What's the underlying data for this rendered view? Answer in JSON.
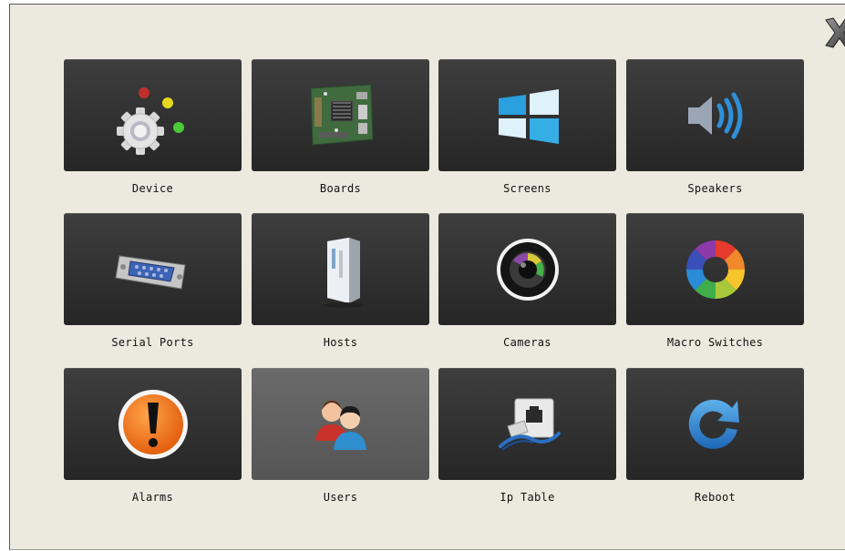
{
  "window": {
    "close_icon": "close-x-icon"
  },
  "tiles": [
    {
      "label": "Device",
      "icon": "gear-leds-icon",
      "selected": false
    },
    {
      "label": "Boards",
      "icon": "circuit-board-icon",
      "selected": false
    },
    {
      "label": "Screens",
      "icon": "screens-windows-icon",
      "selected": false
    },
    {
      "label": "Speakers",
      "icon": "speaker-icon",
      "selected": false
    },
    {
      "label": "Serial Ports",
      "icon": "serial-port-icon",
      "selected": false
    },
    {
      "label": "Hosts",
      "icon": "server-tower-icon",
      "selected": false
    },
    {
      "label": "Cameras",
      "icon": "camera-lens-icon",
      "selected": false
    },
    {
      "label": "Macro Switches",
      "icon": "color-wheel-icon",
      "selected": false
    },
    {
      "label": "Alarms",
      "icon": "alarm-exclamation-icon",
      "selected": false
    },
    {
      "label": "Users",
      "icon": "users-icon",
      "selected": true
    },
    {
      "label": "Ip Table",
      "icon": "network-port-icon",
      "selected": false
    },
    {
      "label": "Reboot",
      "icon": "reboot-arrow-icon",
      "selected": false
    }
  ],
  "colors": {
    "panel_bg": "#ece9de",
    "tile_bg": "#2f2f2f",
    "tile_selected_bg": "#606060"
  }
}
